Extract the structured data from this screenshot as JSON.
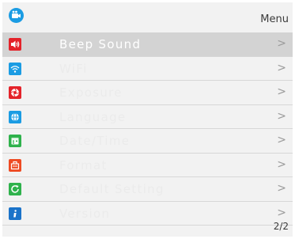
{
  "header": {
    "title": "Menu",
    "icon": "camera-icon"
  },
  "menu": {
    "items": [
      {
        "label": "Beep Sound",
        "icon": "speaker-icon",
        "color": "#e4232a",
        "selected": true
      },
      {
        "label": "WiFi",
        "icon": "wifi-icon",
        "color": "#1b9ce3",
        "selected": false
      },
      {
        "label": "Exposure",
        "icon": "aperture-icon",
        "color": "#e4232a",
        "selected": false
      },
      {
        "label": "Language",
        "icon": "globe-icon",
        "color": "#1b9ce3",
        "selected": false
      },
      {
        "label": "Date/Time",
        "icon": "calendar-icon",
        "color": "#2fb24c",
        "selected": false
      },
      {
        "label": "Format",
        "icon": "format-icon",
        "color": "#ee4a22",
        "selected": false
      },
      {
        "label": "Default Setting",
        "icon": "reset-icon",
        "color": "#2fb24c",
        "selected": false
      },
      {
        "label": "Version",
        "icon": "info-icon",
        "color": "#1b73c9",
        "selected": false
      }
    ],
    "chevron": ">"
  },
  "footer": {
    "page": "2/2"
  }
}
